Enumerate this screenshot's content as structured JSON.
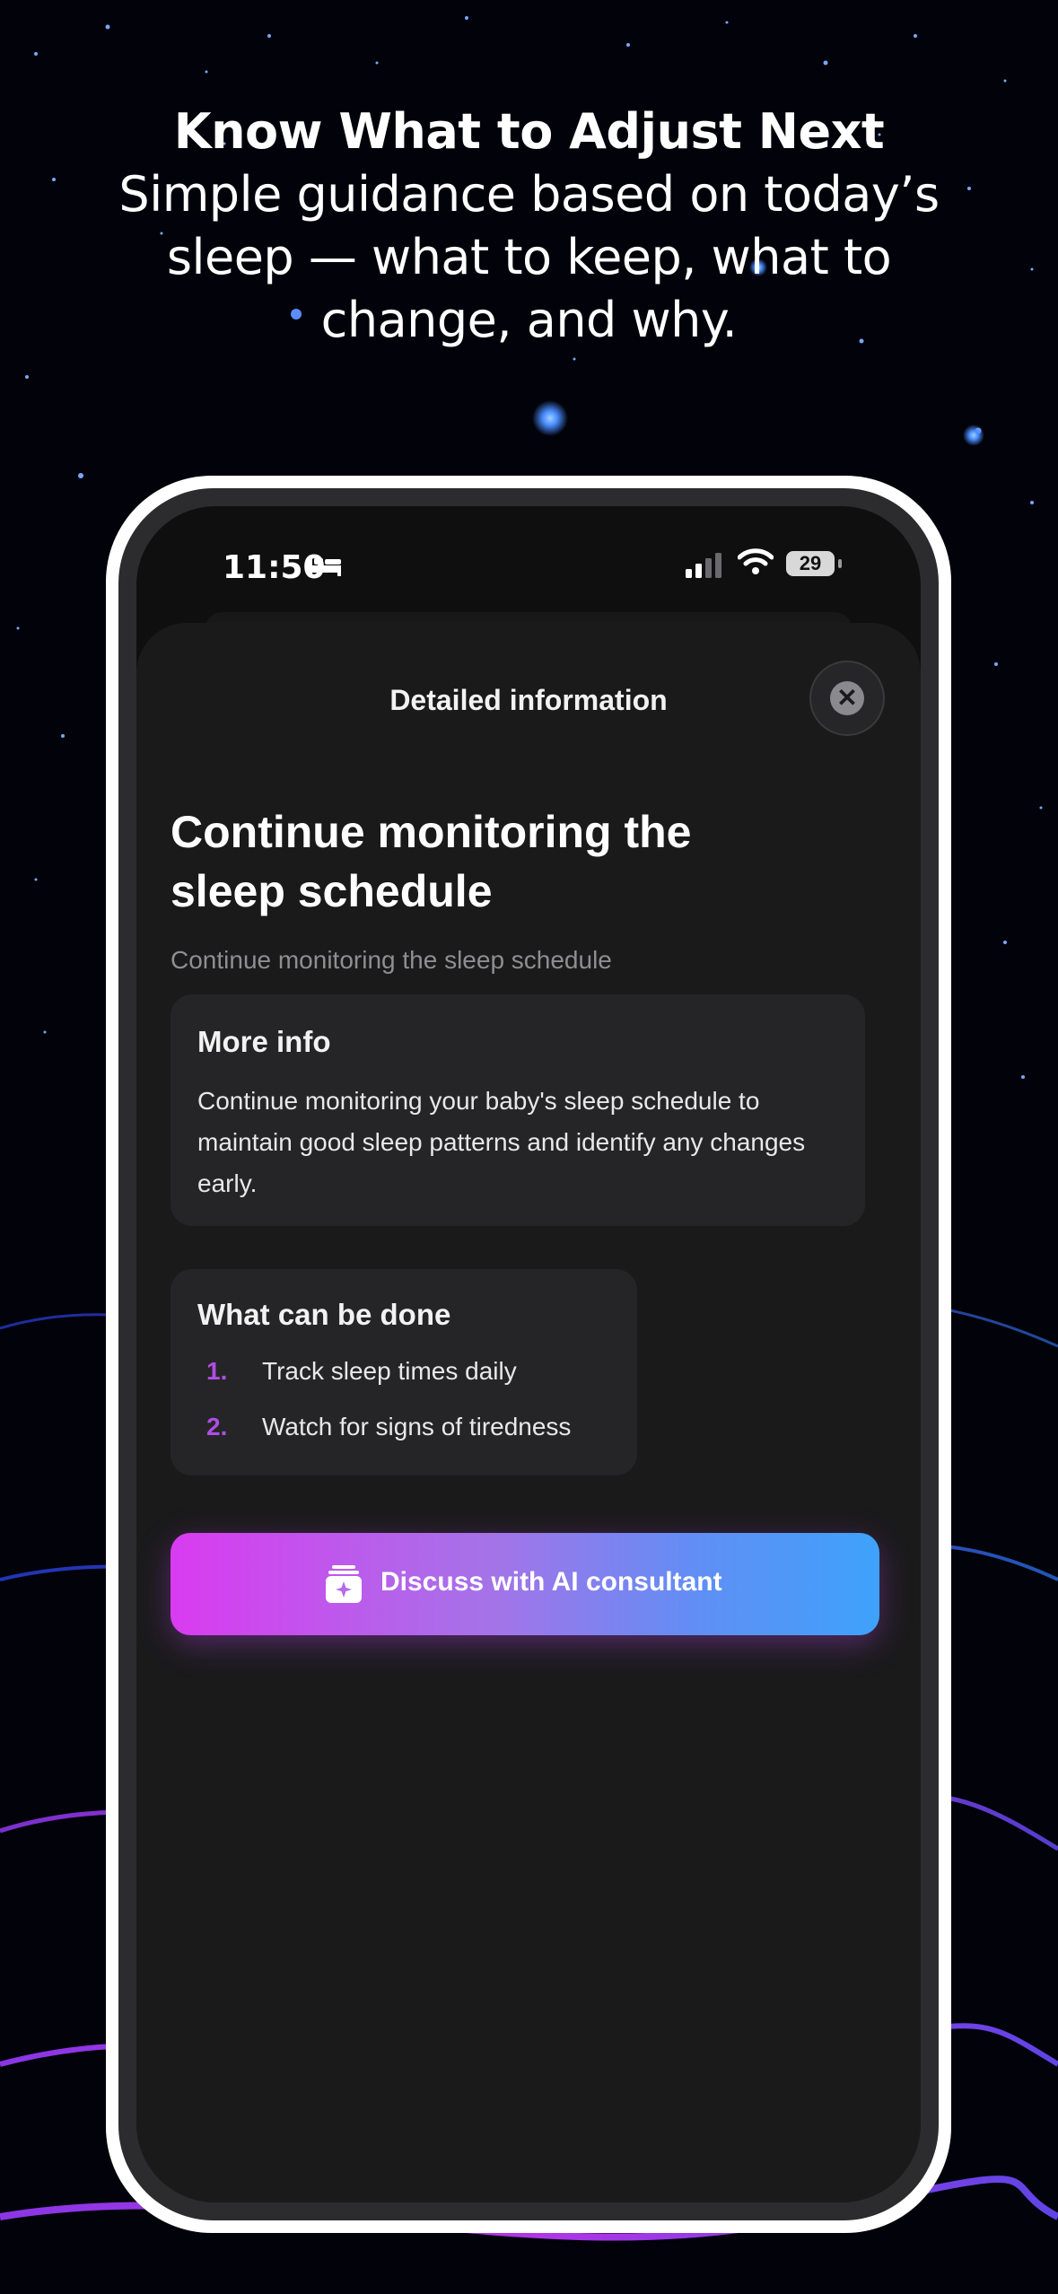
{
  "headline": {
    "title": "Know What to Adjust Next",
    "subtitle": "Simple guidance based on today’s sleep — what to keep, what to change, and why."
  },
  "status_bar": {
    "time": "11:50",
    "battery": "29",
    "icons": [
      "bed-icon",
      "cellular-signal-icon",
      "wifi-icon",
      "battery-icon"
    ]
  },
  "sheet": {
    "title": "Detailed information",
    "close_icon": "close-icon",
    "heading": "Continue monitoring the sleep schedule",
    "subheading": "Continue monitoring the sleep schedule"
  },
  "more_info": {
    "title": "More info",
    "body": "Continue monitoring your baby's sleep schedule to maintain good sleep patterns and identify any changes early."
  },
  "actions": {
    "title": "What can be done",
    "items": [
      {
        "number": "1.",
        "text": "Track sleep times daily"
      },
      {
        "number": "2.",
        "text": "Watch for signs of tiredness"
      }
    ]
  },
  "cta": {
    "label": "Discuss with AI consultant",
    "icon": "ai-consultant-icon"
  },
  "colors": {
    "background": "#02020a",
    "accent_purple": "#b04de6",
    "gradient_start": "#d93bf0",
    "gradient_end": "#3ea2fb"
  }
}
